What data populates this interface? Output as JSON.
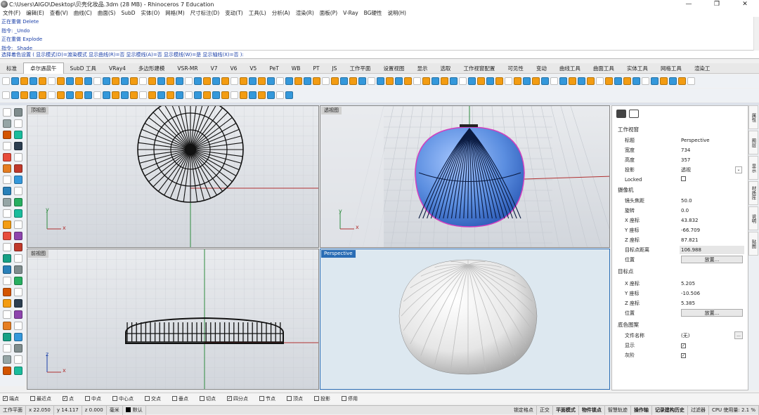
{
  "window": {
    "title": "C:\\Users\\AIGO\\Desktop\\贝壳化妆品.3dm (28 MB) - Rhinoceros 7 Education",
    "controls": [
      "—",
      "❐",
      "✕"
    ]
  },
  "menu": [
    "文件(F)",
    "编辑(E)",
    "查看(V)",
    "曲线(C)",
    "曲面(S)",
    "SubD",
    "实体(O)",
    "网格(M)",
    "尺寸标注(D)",
    "变动(T)",
    "工具(L)",
    "分析(A)",
    "渲染(R)",
    "面板(P)",
    "V-Ray",
    "BG硬性",
    "说明(H)"
  ],
  "command_history": [
    "正在重做 Delete",
    "指令: _Undo",
    "正在重做 Explode",
    "指令: _Shade"
  ],
  "command_prompt": "选择着色设置 ( 显示模式(D)=渡染模式  显示曲线(R)=否  显示模线(A)=否  显示模线(W)=是  显示轴线(X)=否 ):",
  "toolbar_tabs": [
    "标准",
    "卓尔遇晨午",
    "SubD 工具",
    "VRay4",
    "多边形建模",
    "VSR-MR",
    "V7",
    "V6",
    "V5",
    "PeT",
    "WB",
    "PT",
    "JS",
    "工作平面",
    "设置视图",
    "显示",
    "选取",
    "工作视窗配置",
    "可见性",
    "变动",
    "曲线工具",
    "曲面工具",
    "实体工具",
    "网格工具",
    "渲染工"
  ],
  "active_tab_index": 1,
  "viewports": {
    "top": "顶视图",
    "perspective_shaded": "透视图",
    "front": "前视图",
    "perspective_rendered": "Perspective"
  },
  "axes": {
    "x": "x",
    "y": "y",
    "z": "z"
  },
  "panel": {
    "section_view": "工作视窗",
    "rows_view": [
      {
        "k": "标题",
        "v": "Perspective"
      },
      {
        "k": "宽度",
        "v": "734"
      },
      {
        "k": "高度",
        "v": "357"
      },
      {
        "k": "投影",
        "v": "透视"
      },
      {
        "k": "Locked",
        "v": ""
      }
    ],
    "section_camera": "摄像机",
    "rows_camera": [
      {
        "k": "镜头焦距",
        "v": "50.0"
      },
      {
        "k": "旋转",
        "v": "0.0"
      },
      {
        "k": "X 座标",
        "v": "43.832"
      },
      {
        "k": "Y 座标",
        "v": "-66.709"
      },
      {
        "k": "Z 座标",
        "v": "87.821"
      },
      {
        "k": "目标点距离",
        "v": "106.988"
      },
      {
        "k": "位置",
        "v": ""
      }
    ],
    "place_button": "放置...",
    "section_target": "目标点",
    "rows_target": [
      {
        "k": "X 座标",
        "v": "5.205"
      },
      {
        "k": "Y 座标",
        "v": "-10.506"
      },
      {
        "k": "Z 座标",
        "v": "5.385"
      },
      {
        "k": "位置",
        "v": ""
      }
    ],
    "section_bg": "底色图案",
    "rows_bg": [
      {
        "k": "文件名称",
        "v": "(无)"
      },
      {
        "k": "显示",
        "v": ""
      },
      {
        "k": "灰阶",
        "v": ""
      }
    ]
  },
  "side_tabs": [
    "属性",
    "图层",
    "显示",
    "材质库",
    "说明",
    "贴图"
  ],
  "osnaps": [
    {
      "label": "端点",
      "checked": true
    },
    {
      "label": "最近点",
      "checked": false
    },
    {
      "label": "点",
      "checked": true
    },
    {
      "label": "中点",
      "checked": false
    },
    {
      "label": "中心点",
      "checked": false
    },
    {
      "label": "交点",
      "checked": false
    },
    {
      "label": "垂点",
      "checked": false
    },
    {
      "label": "切点",
      "checked": false
    },
    {
      "label": "四分点",
      "checked": true
    },
    {
      "label": "节点",
      "checked": false
    },
    {
      "label": "顶点",
      "checked": false
    },
    {
      "label": "投影",
      "checked": false
    },
    {
      "label": "停用",
      "checked": false
    }
  ],
  "status": {
    "cplane": "工作平面",
    "x": "x 22.050",
    "y": "y 14.117",
    "z": "z 0.000",
    "unit": "毫米",
    "layer": "默认",
    "items": [
      "锁定格点",
      "正交",
      "平面模式",
      "物件锁点",
      "智慧轨迹",
      "操作轴",
      "记录建构历史",
      "过滤器",
      "CPU 使用量: 2.1 %"
    ]
  },
  "colors": {
    "accent": "#2a6db5",
    "blue_surface": "#5b8ee0",
    "x_axis": "#c0392b",
    "y_axis": "#27ae60"
  }
}
